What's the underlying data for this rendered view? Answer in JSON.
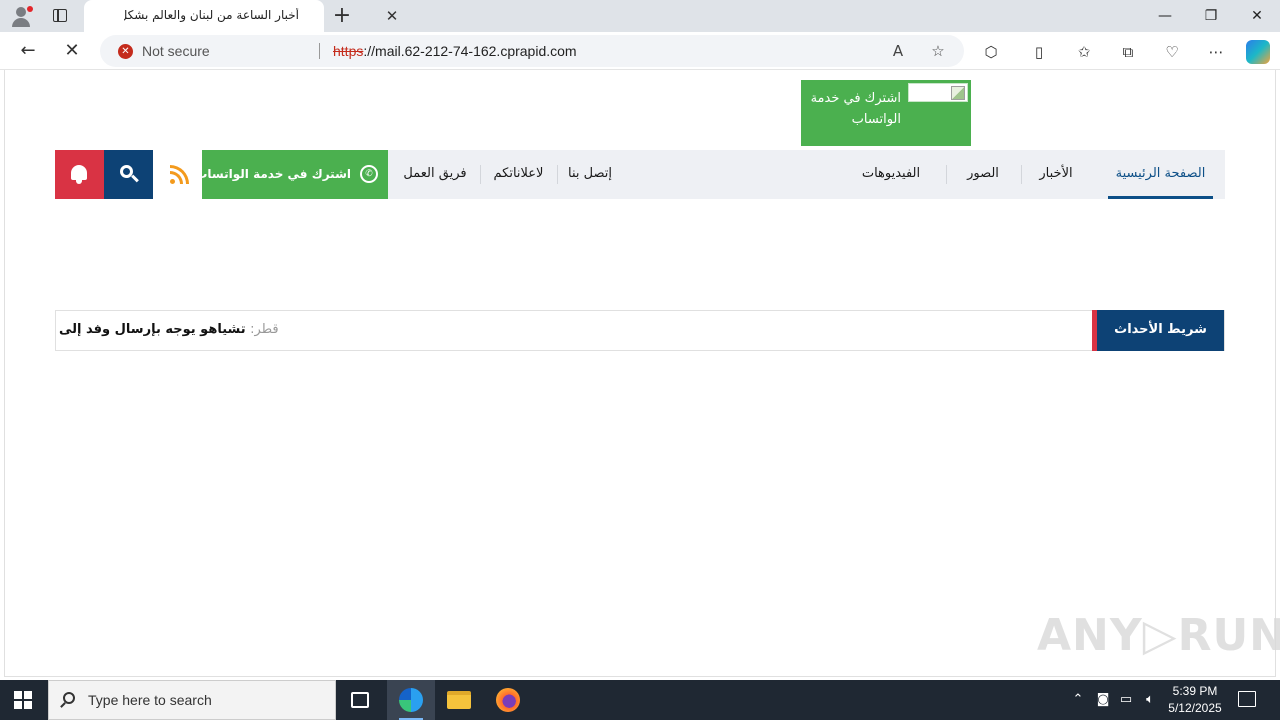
{
  "browser": {
    "tab_title": "أخبار الساعة من لبنان والعالم بشكل",
    "tab_close": "✕",
    "new_tab": "+",
    "minimize": "—",
    "restore": "❐",
    "close": "✕",
    "security_label": "Not secure",
    "url_scheme": "https",
    "url_rest": "://mail.62-212-74-162.cprapid.com",
    "icons": [
      "back-icon",
      "stop-icon",
      "read-aloud-icon",
      "favorite-star-icon",
      "extensions-icon",
      "split-screen-icon",
      "favorites-icon",
      "collections-icon",
      "performance-icon",
      "more-icon",
      "copilot-icon"
    ]
  },
  "site": {
    "whatsapp_banner": "اشترك في خدمة الواتساب",
    "nav": {
      "home": "الصفحة الرئيسية",
      "news": "الأخبار",
      "photos": "الصور",
      "videos": "الفيديوهات",
      "contact": "إتصل بنا",
      "ads": "لاعلاناتكم",
      "team": "فريق العمل",
      "whatsapp": "اشترك في خدمة الواتساب"
    },
    "ticker": {
      "label": "شريط الأحداث",
      "category": "قطر:",
      "headline": "تشياهو يوجه بإرسال وفد إلى"
    },
    "watermark": "ANY▷RUN"
  },
  "taskbar": {
    "search_placeholder": "Type here to search",
    "time": "5:39 PM",
    "date": "5/12/2025"
  },
  "colors": {
    "nav_active": "#0c4f87",
    "whatsapp_green": "#4bb04f",
    "search_blue": "#0d4275",
    "bell_red": "#d93344",
    "rss_orange": "#f39a1d"
  }
}
